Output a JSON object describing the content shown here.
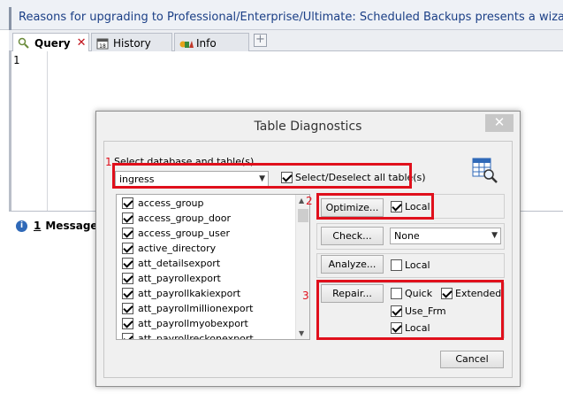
{
  "banner": {
    "text": "Reasons for upgrading to Professional/Enterprise/Ultimate: Scheduled Backups presents a wizard"
  },
  "tabs": [
    {
      "label": "Query",
      "close": "✕"
    },
    {
      "label": "History",
      "icon_text": "18"
    },
    {
      "label": "Info"
    }
  ],
  "add_tab_label": "+",
  "editor": {
    "line_number": "1"
  },
  "messages_tab": {
    "number": "1",
    "label": "Message"
  },
  "dialog": {
    "title": "Table Diagnostics",
    "close": "✕",
    "select_label": "Select database and table(s)",
    "database": "ingress",
    "select_all_label": "Select/Deselect all table(s)",
    "tables": [
      "access_group",
      "access_group_door",
      "access_group_user",
      "active_directory",
      "att_detailsexport",
      "att_payrollexport",
      "att_payrollkakiexport",
      "att_payrollmillionexport",
      "att_payrollmyobexport",
      "att_payrollreckonexport"
    ],
    "optimize": {
      "button": "Optimize...",
      "local_label": "Local"
    },
    "check": {
      "button": "Check...",
      "option": "None"
    },
    "analyze": {
      "button": "Analyze...",
      "local_label": "Local"
    },
    "repair": {
      "button": "Repair...",
      "quick_label": "Quick",
      "extended_label": "Extended",
      "usefrm_label": "Use_Frm",
      "local_label": "Local"
    },
    "cancel": "Cancel"
  },
  "annotations": [
    "1",
    "2",
    "3"
  ],
  "colors": {
    "annotation_red": "#e0101c",
    "banner_text": "#1b3f86"
  }
}
